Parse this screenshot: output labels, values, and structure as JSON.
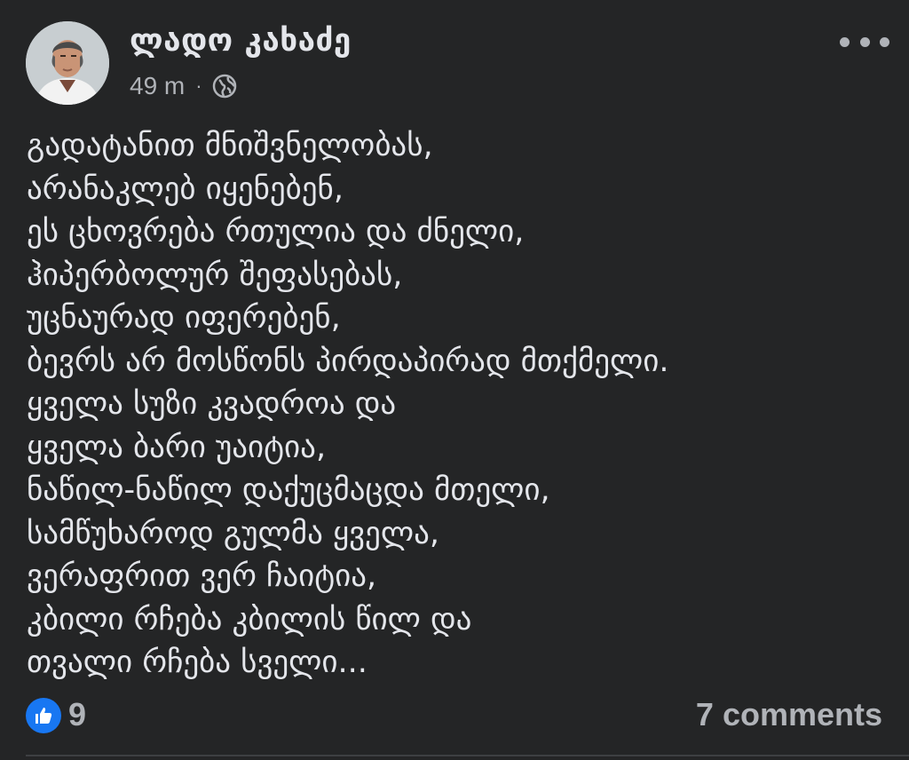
{
  "post": {
    "author": "ლადო კახაძე",
    "time": "49 m",
    "separator": "·",
    "privacy_icon": "globe-icon",
    "menu_icon": "more-horizontal-icon",
    "lines": [
      "გადატანით მნიშვნელობას,",
      "არანაკლებ იყენებენ,",
      "ეს ცხოვრება რთულია და ძნელი,",
      "ჰიპერბოლურ შეფასებას,",
      "უცნაურად იფერებენ,",
      "ბევრს არ მოსწონს პირდაპირად მთქმელი.",
      "ყველა სუზი კვადროა და",
      "ყველა ბარი უაიტია,",
      "ნაწილ-ნაწილ დაქუცმაცდა მთელი,",
      "სამწუხაროდ გულმა ყველა,",
      "ვერაფრით ვერ ჩაიტია,",
      "კბილი რჩება კბილის წილ და",
      "თვალი რჩება სველი..."
    ]
  },
  "reactions": {
    "icon": "like-icon",
    "count": "9"
  },
  "comments": {
    "label": "7 comments"
  },
  "colors": {
    "background": "#242526",
    "primary_text": "#e4e6eb",
    "secondary_text": "#b0b3b8",
    "like_blue": "#1877f2"
  }
}
